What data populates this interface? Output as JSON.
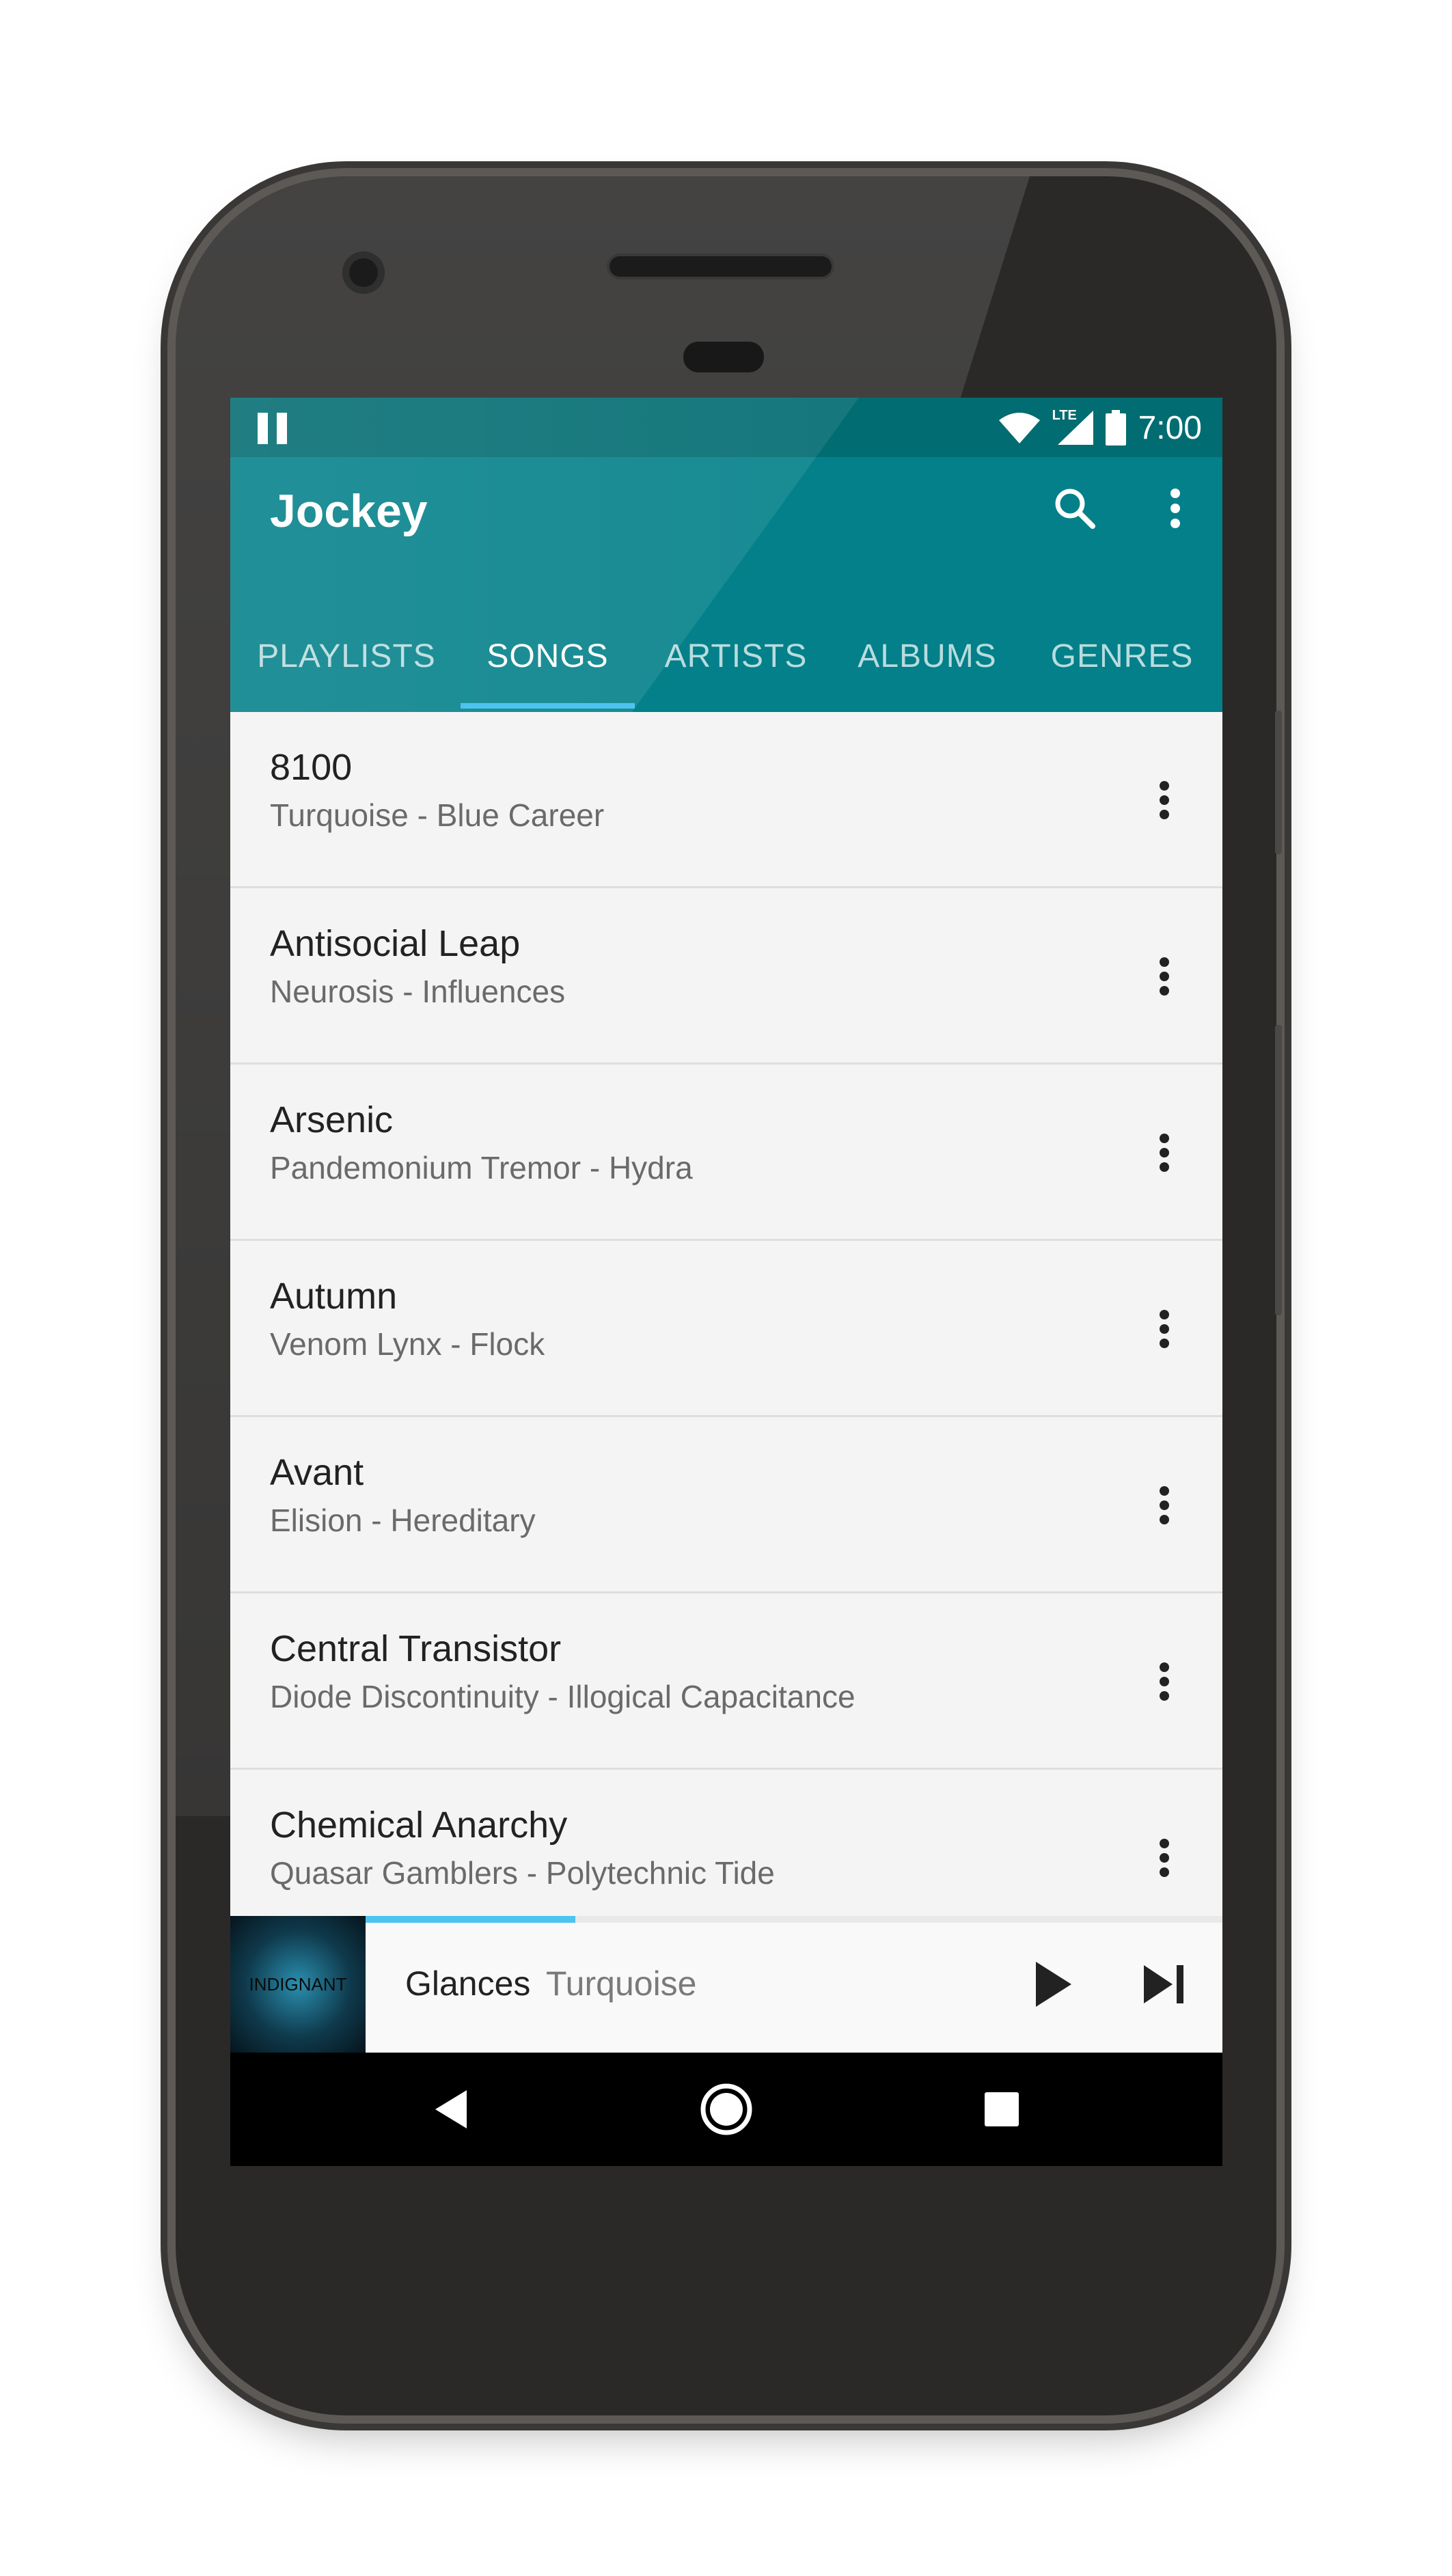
{
  "status_bar": {
    "time": "7:00",
    "network_label": "LTE"
  },
  "app_bar": {
    "title": "Jockey",
    "search_icon": "search-icon",
    "overflow_icon": "more-vert-icon",
    "colors": {
      "status": "#016c71",
      "toolbar": "#038089",
      "indicator": "#4ec3f0"
    }
  },
  "tabs": [
    {
      "label": "PLAYLISTS",
      "active": false
    },
    {
      "label": "SONGS",
      "active": true
    },
    {
      "label": "ARTISTS",
      "active": false
    },
    {
      "label": "ALBUMS",
      "active": false
    },
    {
      "label": "GENRES",
      "active": false
    }
  ],
  "songs": [
    {
      "title": "8100",
      "subtitle": "Turquoise - Blue Career"
    },
    {
      "title": "Antisocial Leap",
      "subtitle": "Neurosis - Influences"
    },
    {
      "title": "Arsenic",
      "subtitle": "Pandemonium Tremor - Hydra"
    },
    {
      "title": "Autumn",
      "subtitle": "Venom Lynx - Flock"
    },
    {
      "title": "Avant",
      "subtitle": "Elision - Hereditary"
    },
    {
      "title": "Central Transistor",
      "subtitle": "Diode Discontinuity - Illogical Capacitance"
    },
    {
      "title": "Chemical Anarchy",
      "subtitle": "Quasar Gamblers - Polytechnic Tide"
    }
  ],
  "now_playing": {
    "title": "Glances",
    "artist": "Turquoise",
    "album_art_text": "INDIGNANT",
    "progress": 0.245,
    "play_icon": "play-icon",
    "next_icon": "skip-next-icon"
  },
  "nav_bar": {
    "back_icon": "back-icon",
    "home_icon": "home-icon",
    "recents_icon": "recents-icon"
  }
}
